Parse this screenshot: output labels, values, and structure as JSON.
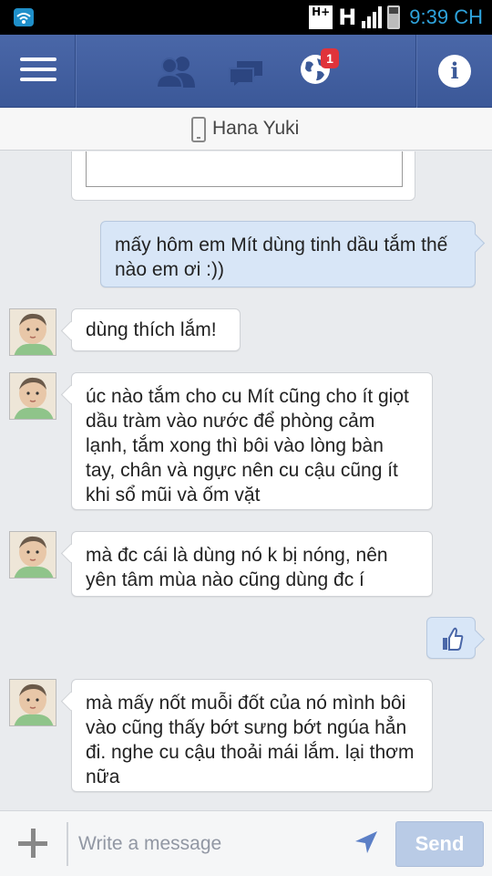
{
  "status_bar": {
    "network_badge": "H+",
    "network_type": "H",
    "time": "9:39 CH"
  },
  "nav": {
    "notification_count": "1",
    "info_label": "i"
  },
  "conversation": {
    "contact_name": "Hana Yuki"
  },
  "messages": [
    {
      "direction": "out",
      "text": "mấy hôm em Mít dùng tinh dầu tắm thế nào em ơi :))"
    },
    {
      "direction": "in",
      "text": "dùng thích lắm!"
    },
    {
      "direction": "in",
      "text": "úc nào tắm cho cu Mít cũng cho ít giọt dầu tràm vào nước để phòng cảm lạnh, tắm xong thì bôi vào lòng bàn tay, chân và ngực nên cu cậu cũng ít khi sổ mũi và ốm vặt"
    },
    {
      "direction": "in",
      "text": "mà đc cái là dùng nó k bị nóng, nên yên tâm mùa nào cũng dùng đc í"
    },
    {
      "direction": "out",
      "type": "like-sticker"
    },
    {
      "direction": "in",
      "text": "mà mấy nốt muỗi đốt của nó mình bôi vào cũng thấy bớt sưng bớt ngúa hẳn đi. nghe cu cậu thoải mái lắm. lại thơm nữa"
    }
  ],
  "composer": {
    "placeholder": "Write a message",
    "send_label": "Send"
  },
  "icons": [
    "wifi-icon",
    "menu-icon",
    "friends-icon",
    "messages-icon",
    "globe-icon",
    "info-icon",
    "phone-icon",
    "plus-icon",
    "location-arrow-icon",
    "thumbs-up-icon"
  ],
  "colors": {
    "navbar": "#3b5998",
    "badge": "#e0333b",
    "outgoing_bubble": "#d8e6f7",
    "send_button": "#b9cbe6",
    "clock": "#2ea3dc"
  }
}
